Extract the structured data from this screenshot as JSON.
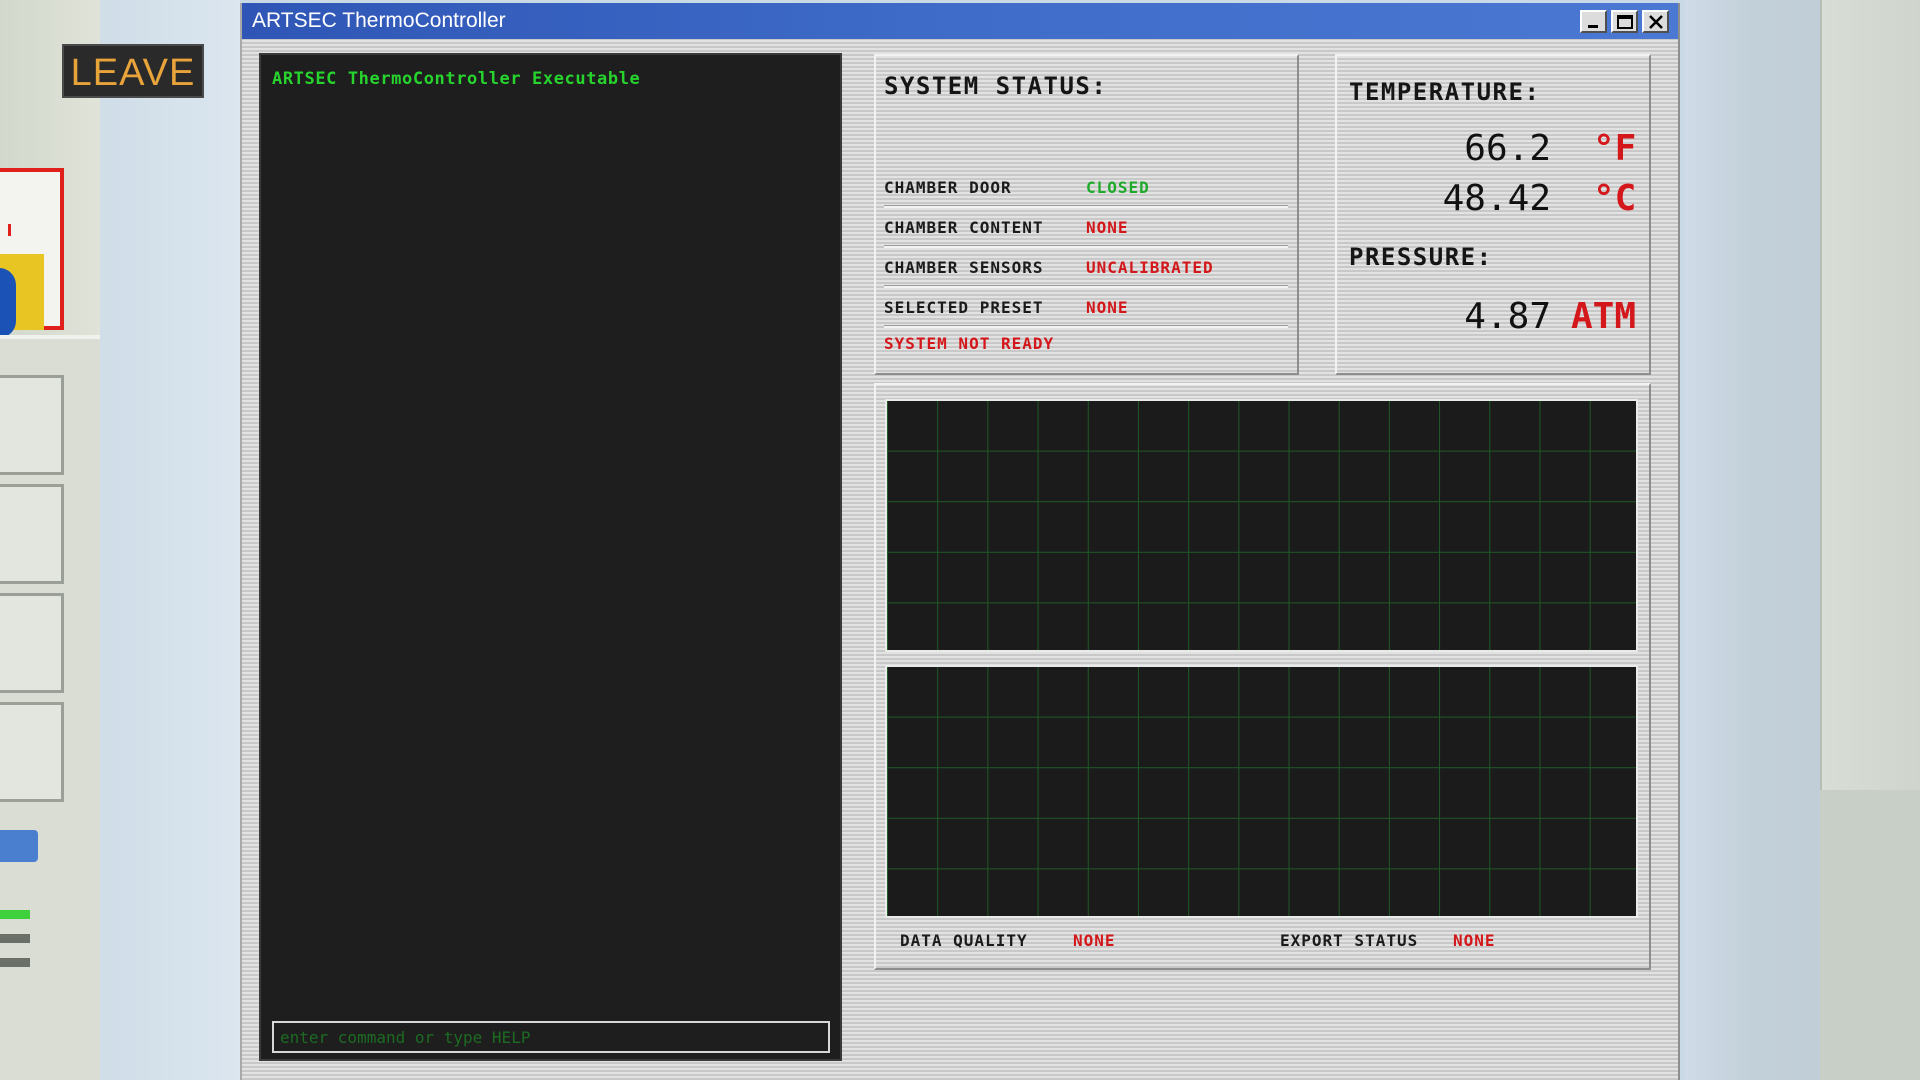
{
  "hud": {
    "leave_label": "LEAVE"
  },
  "window": {
    "title": "ARTSEC ThermoController",
    "controls": [
      "minimize",
      "maximize",
      "close"
    ]
  },
  "console": {
    "lines": [
      "ARTSEC ThermoController Executable"
    ],
    "input_placeholder": "enter command or type HELP",
    "input_value": ""
  },
  "system_status": {
    "heading": "SYSTEM STATUS:",
    "rows": [
      {
        "label": "CHAMBER DOOR",
        "value": "CLOSED",
        "status": "ok"
      },
      {
        "label": "CHAMBER CONTENT",
        "value": "NONE",
        "status": "bad"
      },
      {
        "label": "CHAMBER SENSORS",
        "value": "UNCALIBRATED",
        "status": "bad"
      },
      {
        "label": "SELECTED PRESET",
        "value": "NONE",
        "status": "bad"
      }
    ],
    "overall": "SYSTEM NOT READY"
  },
  "temperature": {
    "heading": "TEMPERATURE:",
    "fahrenheit": "66.2",
    "fahrenheit_unit": "°F",
    "celsius": "48.42",
    "celsius_unit": "°C"
  },
  "pressure": {
    "heading": "PRESSURE:",
    "value": "4.87",
    "unit": "ATM"
  },
  "graphs": {
    "data_quality_label": "DATA QUALITY",
    "data_quality_value": "NONE",
    "export_status_label": "EXPORT STATUS",
    "export_status_value": "NONE"
  },
  "colors": {
    "ok": "#1faa2a",
    "bad": "#d3171a",
    "console_text": "#27d32d",
    "titlebar": "#3f6cc9"
  }
}
